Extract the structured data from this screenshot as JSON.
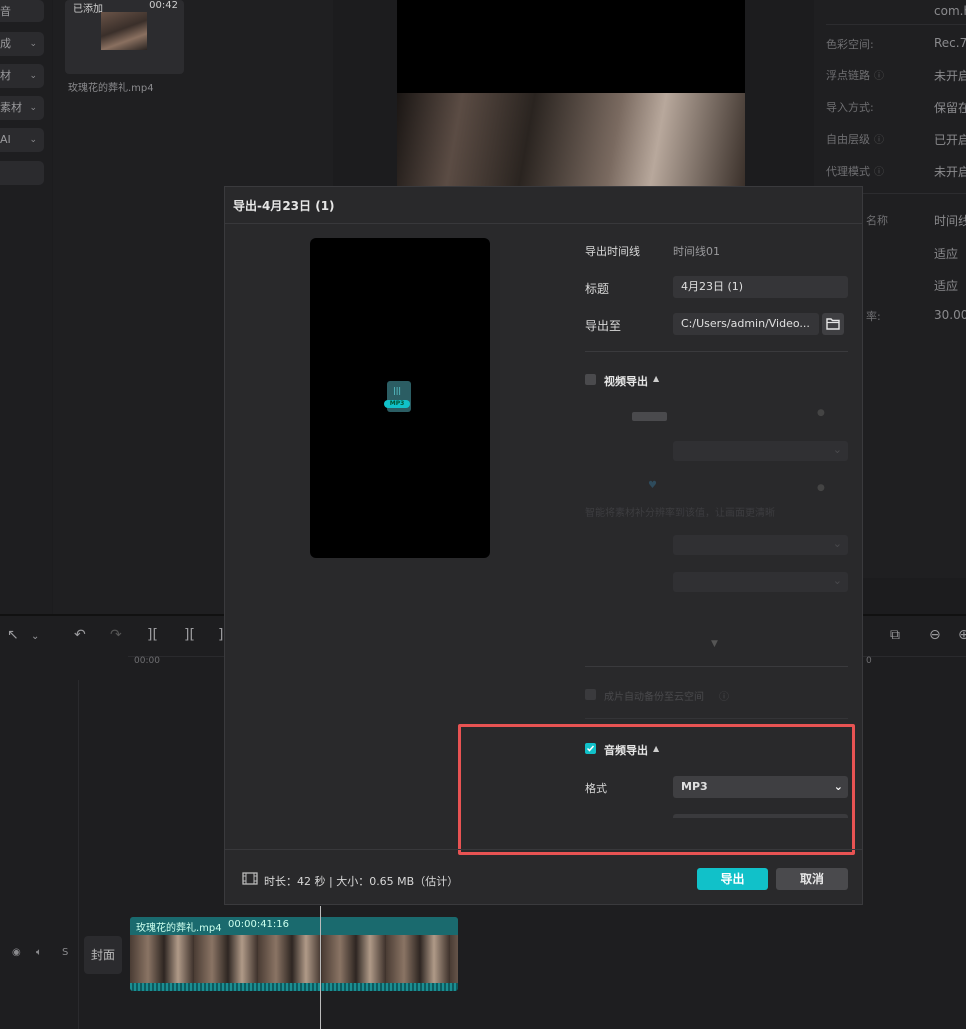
{
  "media": {
    "added_label": "已添加",
    "duration": "00:42",
    "filename": "玫瑰花的葬礼.mp4"
  },
  "sidebar": {
    "items": [
      {
        "label": "音"
      },
      {
        "label": "成"
      },
      {
        "label": "材"
      },
      {
        "label": "素材"
      },
      {
        "label": "AI"
      }
    ]
  },
  "properties": {
    "top_value": "com.h",
    "rows": [
      {
        "label": "色彩空间:",
        "value": "Rec.7"
      },
      {
        "label": "浮点链路",
        "value": "未开启"
      },
      {
        "label": "导入方式:",
        "value": "保留在"
      },
      {
        "label": "自由层级",
        "value": "已开启"
      },
      {
        "label": "代理模式",
        "value": "未开启"
      },
      {
        "label": "名称",
        "value": "时间线"
      },
      {
        "label": "",
        "value": "适应"
      },
      {
        "label": "",
        "value": "适应"
      },
      {
        "label": "率:",
        "value": "30.00"
      }
    ]
  },
  "timeline": {
    "ruler_start": "00:00",
    "ruler_right": "0",
    "cover_label": "封面",
    "clip_label": "玫瑰花的葬礼.mp4",
    "clip_duration": "00:00:41:16",
    "track_s": "S"
  },
  "dialog": {
    "title": "导出-4月23日 (1)",
    "timeline_label": "导出时间线",
    "timeline_value": "时间线01",
    "title_label": "标题",
    "title_value": "4月23日 (1)",
    "export_to_label": "导出至",
    "export_path": "C:/Users/admin/Video...",
    "video_export_label": "视频导出",
    "video_export_checked": false,
    "ghost_hint": "智能将素材补分辨率到该值，让画面更清晰",
    "cloud_backup_label": "成片自动备份至云空间",
    "audio_export_label": "音频导出",
    "audio_export_checked": true,
    "format_label": "格式",
    "format_value": "MP3",
    "preview_badge": "MP3",
    "footer_info": "时长：42 秒 | 大小：0.65 MB（估计）",
    "export_button": "导出",
    "cancel_button": "取消"
  },
  "colors": {
    "accent": "#11c1c9",
    "highlight": "#e85353"
  }
}
